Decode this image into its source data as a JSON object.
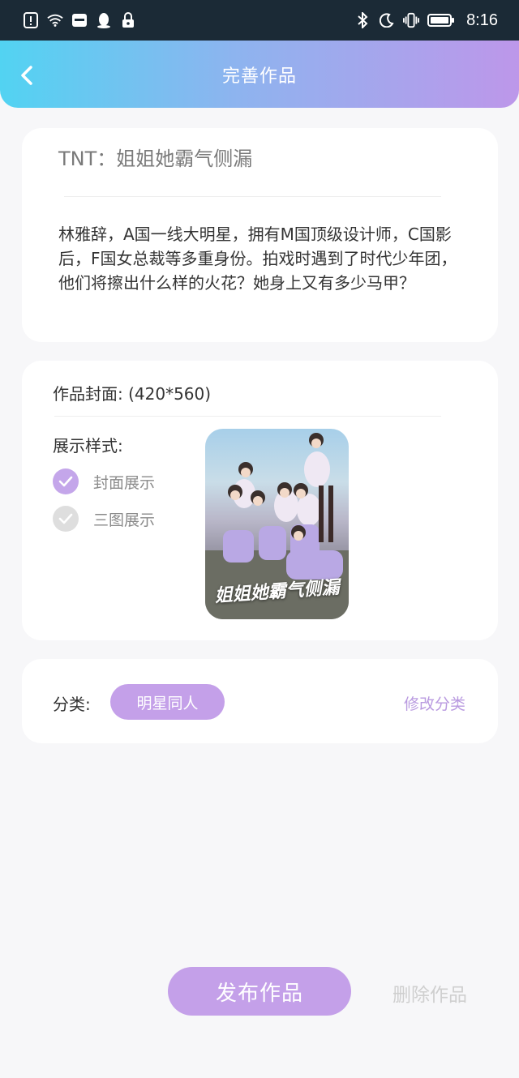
{
  "status_bar": {
    "time": "8:16"
  },
  "header": {
    "title": "完善作品"
  },
  "work": {
    "title": "TNT：姐姐她霸气侧漏",
    "description": "林雅辞，A国一线大明星，拥有M国顶级设计师，C国影后，F国女总裁等多重身份。拍戏时遇到了时代少年团，他们将擦出什么样的火花？她身上又有多少马甲？"
  },
  "cover": {
    "label": "作品封面: (420*560)",
    "style_label": "展示样式:",
    "options": [
      {
        "label": "封面展示",
        "checked": true
      },
      {
        "label": "三图展示",
        "checked": false
      }
    ],
    "image_text": "姐姐她霸气侧漏"
  },
  "category": {
    "label": "分类:",
    "value": "明星同人",
    "edit_label": "修改分类"
  },
  "actions": {
    "publish_label": "发布作品",
    "delete_label": "删除作品"
  },
  "colors": {
    "accent": "#c4a0e9",
    "header_start": "#52d3f2",
    "header_end": "#bd97ea"
  }
}
